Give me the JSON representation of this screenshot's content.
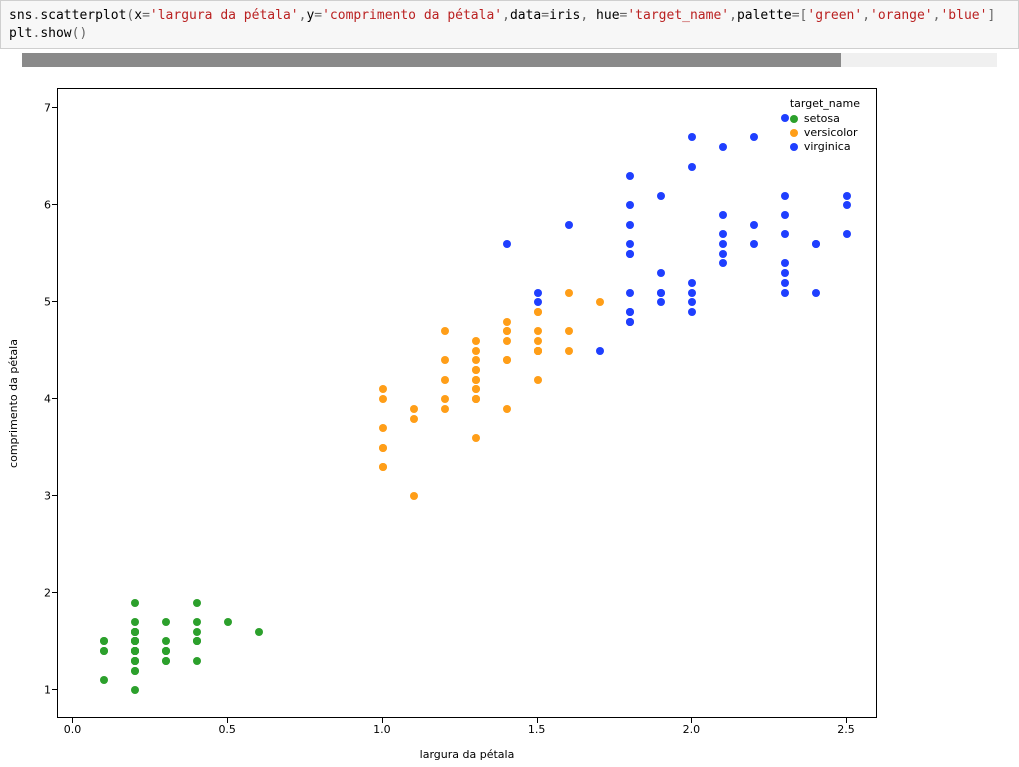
{
  "code": {
    "x_str": "'largura da pétala'",
    "y_str": "'comprimento da pétala'",
    "data_var": "iris",
    "hue_str": "'target_name'",
    "palette": [
      "'green'",
      "'orange'",
      "'blue'"
    ]
  },
  "chart_data": {
    "type": "scatter",
    "xlabel": "largura da pétala",
    "ylabel": "comprimento da pétala",
    "legend_title": "target_name",
    "xticks": [
      0.0,
      0.5,
      1.0,
      1.5,
      2.0,
      2.5
    ],
    "yticks": [
      1,
      2,
      3,
      4,
      5,
      6,
      7
    ],
    "xlim": [
      -0.05,
      2.6
    ],
    "ylim": [
      0.7,
      7.2
    ],
    "colors": {
      "setosa": "#2ca02c",
      "versicolor": "#ff9e18",
      "virginica": "#1f3fff"
    },
    "series": [
      {
        "name": "setosa",
        "color": "green",
        "points": [
          [
            0.2,
            1.4
          ],
          [
            0.2,
            1.4
          ],
          [
            0.2,
            1.3
          ],
          [
            0.2,
            1.5
          ],
          [
            0.2,
            1.4
          ],
          [
            0.4,
            1.7
          ],
          [
            0.3,
            1.4
          ],
          [
            0.2,
            1.5
          ],
          [
            0.2,
            1.4
          ],
          [
            0.1,
            1.5
          ],
          [
            0.2,
            1.5
          ],
          [
            0.2,
            1.6
          ],
          [
            0.1,
            1.4
          ],
          [
            0.1,
            1.1
          ],
          [
            0.2,
            1.2
          ],
          [
            0.4,
            1.5
          ],
          [
            0.4,
            1.3
          ],
          [
            0.3,
            1.4
          ],
          [
            0.3,
            1.7
          ],
          [
            0.3,
            1.5
          ],
          [
            0.2,
            1.7
          ],
          [
            0.4,
            1.5
          ],
          [
            0.2,
            1.0
          ],
          [
            0.5,
            1.7
          ],
          [
            0.2,
            1.9
          ],
          [
            0.2,
            1.6
          ],
          [
            0.4,
            1.6
          ],
          [
            0.2,
            1.5
          ],
          [
            0.2,
            1.4
          ],
          [
            0.2,
            1.6
          ],
          [
            0.2,
            1.6
          ],
          [
            0.4,
            1.5
          ],
          [
            0.1,
            1.5
          ],
          [
            0.2,
            1.4
          ],
          [
            0.2,
            1.5
          ],
          [
            0.2,
            1.2
          ],
          [
            0.2,
            1.3
          ],
          [
            0.1,
            1.4
          ],
          [
            0.2,
            1.3
          ],
          [
            0.2,
            1.5
          ],
          [
            0.3,
            1.3
          ],
          [
            0.3,
            1.3
          ],
          [
            0.2,
            1.3
          ],
          [
            0.6,
            1.6
          ],
          [
            0.4,
            1.9
          ],
          [
            0.3,
            1.4
          ],
          [
            0.2,
            1.6
          ],
          [
            0.2,
            1.4
          ],
          [
            0.2,
            1.5
          ],
          [
            0.2,
            1.4
          ]
        ]
      },
      {
        "name": "versicolor",
        "color": "orange",
        "points": [
          [
            1.4,
            4.7
          ],
          [
            1.5,
            4.5
          ],
          [
            1.5,
            4.9
          ],
          [
            1.3,
            4.0
          ],
          [
            1.5,
            4.6
          ],
          [
            1.3,
            4.5
          ],
          [
            1.6,
            4.7
          ],
          [
            1.0,
            3.3
          ],
          [
            1.3,
            4.6
          ],
          [
            1.4,
            3.9
          ],
          [
            1.0,
            3.5
          ],
          [
            1.5,
            4.2
          ],
          [
            1.0,
            4.0
          ],
          [
            1.4,
            4.7
          ],
          [
            1.3,
            3.6
          ],
          [
            1.4,
            4.4
          ],
          [
            1.5,
            4.5
          ],
          [
            1.0,
            4.1
          ],
          [
            1.5,
            4.5
          ],
          [
            1.1,
            3.9
          ],
          [
            1.8,
            4.8
          ],
          [
            1.3,
            4.0
          ],
          [
            1.5,
            4.9
          ],
          [
            1.2,
            4.7
          ],
          [
            1.3,
            4.3
          ],
          [
            1.4,
            4.4
          ],
          [
            1.4,
            4.8
          ],
          [
            1.7,
            5.0
          ],
          [
            1.5,
            4.5
          ],
          [
            1.0,
            3.5
          ],
          [
            1.1,
            3.8
          ],
          [
            1.0,
            3.7
          ],
          [
            1.2,
            3.9
          ],
          [
            1.6,
            5.1
          ],
          [
            1.5,
            4.5
          ],
          [
            1.6,
            4.5
          ],
          [
            1.5,
            4.7
          ],
          [
            1.3,
            4.4
          ],
          [
            1.3,
            4.1
          ],
          [
            1.3,
            4.0
          ],
          [
            1.2,
            4.4
          ],
          [
            1.4,
            4.6
          ],
          [
            1.2,
            4.0
          ],
          [
            1.0,
            3.3
          ],
          [
            1.3,
            4.2
          ],
          [
            1.2,
            4.2
          ],
          [
            1.3,
            4.2
          ],
          [
            1.3,
            4.3
          ],
          [
            1.1,
            3.0
          ],
          [
            1.3,
            4.1
          ]
        ]
      },
      {
        "name": "virginica",
        "color": "blue",
        "points": [
          [
            2.5,
            6.0
          ],
          [
            1.9,
            5.1
          ],
          [
            2.1,
            5.9
          ],
          [
            1.8,
            5.6
          ],
          [
            2.2,
            5.8
          ],
          [
            2.1,
            6.6
          ],
          [
            1.7,
            4.5
          ],
          [
            1.8,
            6.3
          ],
          [
            1.8,
            5.8
          ],
          [
            2.5,
            6.1
          ],
          [
            2.0,
            5.1
          ],
          [
            1.9,
            5.3
          ],
          [
            2.1,
            5.5
          ],
          [
            2.0,
            5.0
          ],
          [
            2.4,
            5.1
          ],
          [
            2.3,
            5.3
          ],
          [
            1.8,
            5.5
          ],
          [
            2.2,
            6.7
          ],
          [
            2.3,
            6.9
          ],
          [
            1.5,
            5.0
          ],
          [
            2.3,
            5.7
          ],
          [
            2.0,
            4.9
          ],
          [
            2.0,
            6.7
          ],
          [
            1.8,
            4.9
          ],
          [
            2.1,
            5.7
          ],
          [
            1.8,
            6.0
          ],
          [
            1.8,
            4.8
          ],
          [
            1.8,
            4.9
          ],
          [
            2.1,
            5.6
          ],
          [
            1.6,
            5.8
          ],
          [
            1.9,
            6.1
          ],
          [
            2.0,
            6.4
          ],
          [
            2.2,
            5.6
          ],
          [
            1.5,
            5.1
          ],
          [
            1.4,
            5.6
          ],
          [
            2.3,
            6.1
          ],
          [
            2.4,
            5.6
          ],
          [
            1.8,
            5.5
          ],
          [
            1.8,
            4.8
          ],
          [
            2.1,
            5.4
          ],
          [
            2.4,
            5.6
          ],
          [
            2.3,
            5.1
          ],
          [
            1.9,
            5.1
          ],
          [
            2.3,
            5.9
          ],
          [
            2.5,
            5.7
          ],
          [
            2.3,
            5.2
          ],
          [
            1.9,
            5.0
          ],
          [
            2.0,
            5.2
          ],
          [
            2.3,
            5.4
          ],
          [
            1.8,
            5.1
          ]
        ]
      }
    ]
  }
}
